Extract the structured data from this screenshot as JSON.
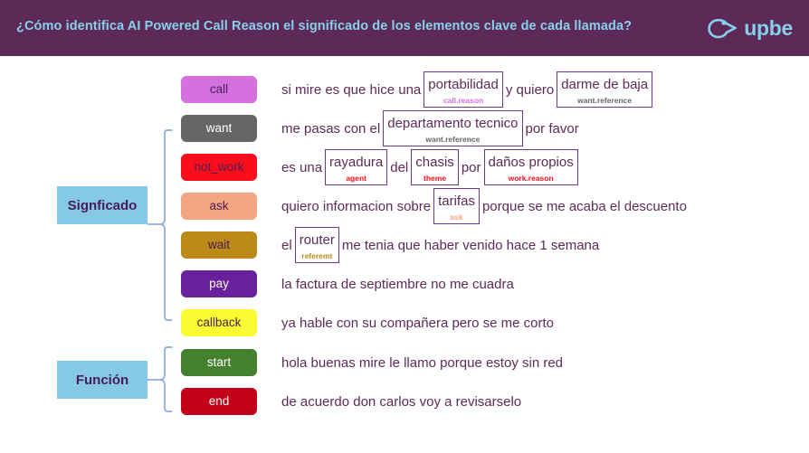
{
  "header": {
    "title": "¿Cómo identifica AI Powered Call Reason el significado de los elementos clave de cada llamada?",
    "logo_text": "upbe",
    "logo_icon": "whistle-icon",
    "background_color": "#5d2a58",
    "text_color": "#86d0ec"
  },
  "groups": [
    {
      "id": "significado",
      "label": "Signficado",
      "color": "#85c8e8",
      "text_color": "#4a1d52"
    },
    {
      "id": "funcion",
      "label": "Función",
      "color": "#85c8e8",
      "text_color": "#4a1d52"
    }
  ],
  "rows": [
    {
      "badge": {
        "label": "call",
        "bg": "#d470e0",
        "fg": "#4a1d52"
      },
      "tokens": [
        {
          "text": "si mire es que hice una",
          "boxed": false
        },
        {
          "text": "portabilidad",
          "boxed": true,
          "tag": "call.reason",
          "tag_color": "#d470e0"
        },
        {
          "text": "y quiero",
          "boxed": false
        },
        {
          "text": "darme de baja",
          "boxed": true,
          "tag": "want.reference",
          "tag_color": "#666666"
        }
      ]
    },
    {
      "badge": {
        "label": "want",
        "bg": "#666666",
        "fg": "#ffffff"
      },
      "tokens": [
        {
          "text": "me pasas con el",
          "boxed": false
        },
        {
          "text": "departamento tecnico",
          "boxed": true,
          "tag": "want.reference",
          "tag_color": "#666666"
        },
        {
          "text": "por favor",
          "boxed": false
        }
      ]
    },
    {
      "badge": {
        "label": "not_work",
        "bg": "#fc0d1b",
        "fg": "#4a1d52"
      },
      "tokens": [
        {
          "text": "es una",
          "boxed": false
        },
        {
          "text": "rayadura",
          "boxed": true,
          "tag": "agent",
          "tag_color": "#fc0d1b"
        },
        {
          "text": "del",
          "boxed": false
        },
        {
          "text": "chasis",
          "boxed": true,
          "tag": "theme",
          "tag_color": "#fc0d1b"
        },
        {
          "text": "por",
          "boxed": false
        },
        {
          "text": "daños propios",
          "boxed": true,
          "tag": "work.reason",
          "tag_color": "#fc0d1b"
        }
      ]
    },
    {
      "badge": {
        "label": "ask",
        "bg": "#f4a582",
        "fg": "#4a1d52"
      },
      "tokens": [
        {
          "text": "quiero informacion sobre",
          "boxed": false
        },
        {
          "text": "tarifas",
          "boxed": true,
          "tag": "ask",
          "tag_color": "#f4a582"
        },
        {
          "text": "porque se me acaba el descuento",
          "boxed": false
        }
      ]
    },
    {
      "badge": {
        "label": "wait",
        "bg": "#bc8a18",
        "fg": "#4a1d52"
      },
      "tokens": [
        {
          "text": "el",
          "boxed": false
        },
        {
          "text": "router",
          "boxed": true,
          "tag": "referemt",
          "tag_color": "#bc8a18"
        },
        {
          "text": "me tenia que haber venido hace 1 semana",
          "boxed": false
        }
      ]
    },
    {
      "badge": {
        "label": "pay",
        "bg": "#6a1f9c",
        "fg": "#ffffff"
      },
      "tokens": [
        {
          "text": "la factura de septiembre no me cuadra",
          "boxed": false
        }
      ]
    },
    {
      "badge": {
        "label": "callback",
        "bg": "#fbfb31",
        "fg": "#4a1d52"
      },
      "tokens": [
        {
          "text": "ya hable con su compañera pero se me corto",
          "boxed": false
        }
      ]
    },
    {
      "badge": {
        "label": "start",
        "bg": "#45802f",
        "fg": "#ffffff"
      },
      "tokens": [
        {
          "text": "hola buenas mire le llamo porque estoy sin red",
          "boxed": false
        }
      ]
    },
    {
      "badge": {
        "label": "end",
        "bg": "#c20017",
        "fg": "#ffffff"
      },
      "tokens": [
        {
          "text": "de acuerdo don carlos voy a revisarselo",
          "boxed": false
        }
      ]
    }
  ],
  "style": {
    "bracket_color": "#8ba8df",
    "sentence_text_color": "#5d2a58",
    "annotation_border_color": "#6a3b8f"
  }
}
